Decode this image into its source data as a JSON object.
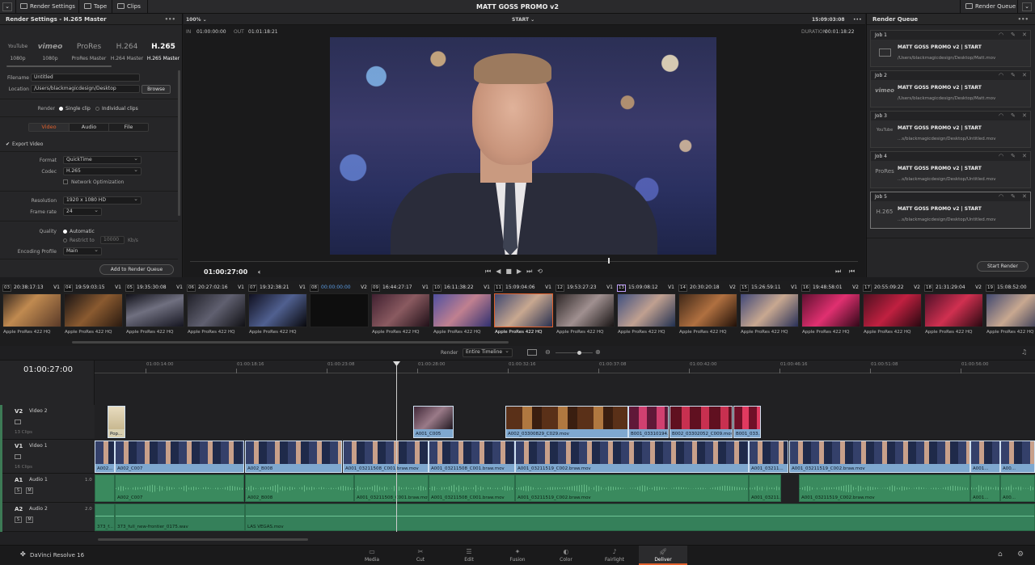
{
  "topbar": {
    "render_settings": "Render Settings",
    "tape": "Tape",
    "clips": "Clips",
    "project_title": "MATT GOSS PROMO v2",
    "render_queue": "Render Queue"
  },
  "render_settings": {
    "header": "Render Settings - H.265 Master",
    "presets": [
      {
        "name": "YouTube",
        "sub": "1080p"
      },
      {
        "name": "vimeo",
        "sub": "1080p"
      },
      {
        "name": "ProRes",
        "sub": "ProRes Master"
      },
      {
        "name": "H.264",
        "sub": "H.264 Master"
      },
      {
        "name": "H.265",
        "sub": "H.265 Master"
      }
    ],
    "filename_label": "Filename",
    "filename_value": "Untitled",
    "location_label": "Location",
    "location_value": "/Users/blackmagicdesign/Desktop",
    "browse": "Browse",
    "render_label": "Render",
    "single_clip": "Single clip",
    "individual_clips": "Individual clips",
    "tabs": [
      "Video",
      "Audio",
      "File"
    ],
    "export_video": "Export Video",
    "format_label": "Format",
    "format_value": "QuickTime",
    "codec_label": "Codec",
    "codec_value": "H.265",
    "network_opt": "Network Optimization",
    "resolution_label": "Resolution",
    "resolution_value": "1920 x 1080 HD",
    "framerate_label": "Frame rate",
    "framerate_value": "24",
    "quality_label": "Quality",
    "automatic": "Automatic",
    "restrict_to": "Restrict to",
    "restrict_value": "10000",
    "restrict_unit": "Kb/s",
    "encoding_label": "Encoding Profile",
    "encoding_value": "Main",
    "add_to_queue": "Add to Render Queue"
  },
  "viewer": {
    "zoom": "100%",
    "marker": "START",
    "timecode": "15:09:03:08",
    "in_label": "IN",
    "in_value": "01:00:00:00",
    "out_label": "OUT",
    "out_value": "01:01:18:21",
    "duration_label": "DURATION",
    "duration_value": "00:01:18:22",
    "current_time": "01:00:27:00"
  },
  "render_queue": {
    "header": "Render Queue",
    "start_render": "Start Render",
    "jobs": [
      {
        "label": "Job 1",
        "logo": "",
        "title": "MATT GOSS PROMO v2 | START",
        "path": "/Users/blackmagicdesign/Desktop/Matt.mov"
      },
      {
        "label": "Job 2",
        "logo": "vimeo",
        "title": "MATT GOSS PROMO v2 | START",
        "path": "/Users/blackmagicdesign/Desktop/Matt.mov"
      },
      {
        "label": "Job 3",
        "logo": "YouTube",
        "title": "MATT GOSS PROMO v2 | START",
        "path": "...s/blackmagicdesign/Desktop/Untitled.mov"
      },
      {
        "label": "Job 4",
        "logo": "ProRes",
        "title": "MATT GOSS PROMO v2 | START",
        "path": "...s/blackmagicdesign/Desktop/Untitled.mov"
      },
      {
        "label": "Job 5",
        "logo": "H.265",
        "title": "MATT GOSS PROMO v2 | START",
        "path": "...s/blackmagicdesign/Desktop/Untitled.mov"
      }
    ]
  },
  "clips": [
    {
      "num": "03",
      "tc": "20:38:17:13",
      "track": "V1",
      "codec": "Apple ProRes 422 HQ"
    },
    {
      "num": "04",
      "tc": "19:59:03:15",
      "track": "V1",
      "codec": "Apple ProRes 422 HQ"
    },
    {
      "num": "05",
      "tc": "19:35:30:08",
      "track": "V1",
      "codec": "Apple ProRes 422 HQ"
    },
    {
      "num": "06",
      "tc": "20:27:02:16",
      "track": "V1",
      "codec": "Apple ProRes 422 HQ"
    },
    {
      "num": "07",
      "tc": "19:32:38:21",
      "track": "V1",
      "codec": "Apple ProRes 422 HQ"
    },
    {
      "num": "08",
      "tc": "00:00:00:00",
      "track": "V2",
      "codec": ""
    },
    {
      "num": "09",
      "tc": "16:44:27:17",
      "track": "V1",
      "codec": "Apple ProRes 422 HQ"
    },
    {
      "num": "10",
      "tc": "16:11:38:22",
      "track": "V1",
      "codec": "Apple ProRes 422 HQ"
    },
    {
      "num": "11",
      "tc": "15:09:04:06",
      "track": "V1",
      "codec": "Apple ProRes 422 HQ"
    },
    {
      "num": "12",
      "tc": "19:53:27:23",
      "track": "V1",
      "codec": "Apple ProRes 422 HQ"
    },
    {
      "num": "13",
      "tc": "15:09:08:12",
      "track": "V1",
      "codec": "Apple ProRes 422 HQ"
    },
    {
      "num": "14",
      "tc": "20:30:20:18",
      "track": "V2",
      "codec": "Apple ProRes 422 HQ"
    },
    {
      "num": "15",
      "tc": "15:26:59:11",
      "track": "V1",
      "codec": "Apple ProRes 422 HQ"
    },
    {
      "num": "16",
      "tc": "19:48:58:01",
      "track": "V2",
      "codec": "Apple ProRes 422 HQ"
    },
    {
      "num": "17",
      "tc": "20:55:09:22",
      "track": "V2",
      "codec": "Apple ProRes 422 HQ"
    },
    {
      "num": "18",
      "tc": "21:31:29:04",
      "track": "V2",
      "codec": "Apple ProRes 422 HQ"
    },
    {
      "num": "19",
      "tc": "15:08:52:00",
      "track": "",
      "codec": "Apple ProRes 422 HQ"
    }
  ],
  "timeline": {
    "render_label": "Render",
    "render_value": "Entire Timeline",
    "timecode": "01:00:27:00",
    "ruler": [
      "01:00:14:00",
      "01:00:18:16",
      "01:00:23:08",
      "01:00:28:00",
      "01:00:32:16",
      "01:00:37:08",
      "01:00:42:00",
      "01:00:46:16",
      "01:00:51:08",
      "01:00:56:00"
    ],
    "tracks": {
      "v2": {
        "tag": "V2",
        "name": "Video 2",
        "count": "13 Clips"
      },
      "v1": {
        "tag": "V1",
        "name": "Video 1",
        "count": "16 Clips"
      },
      "a1": {
        "tag": "A1",
        "name": "Audio 1",
        "level": "1.0"
      },
      "a2": {
        "tag": "A2",
        "name": "Audio 2",
        "level": "2.0"
      }
    },
    "v2_clips": [
      "Pop...",
      "A001_C005",
      "A002_03300829_C029.mov",
      "B001_03310194...",
      "B002_03302052_C009.mov",
      "B001_033..."
    ],
    "v1_clips": [
      "A002...",
      "A002_C007",
      "A002_B008",
      "A001_03211508_C001.braw.mov",
      "A001_03211508_C001.braw.mov",
      "A001_03211519_C002.braw.mov",
      "A001_03211...",
      "A001_03211519_C002.braw.mov",
      "A001...",
      "A00..."
    ],
    "a1_clips": [
      "A002_C007",
      "A002_B008",
      "A001_03211508_C001.braw.mov",
      "A001_03211508_C001.braw.mov",
      "A001_03211519_C002.braw.mov",
      "A001_03211...",
      "A001_03211519_C002.braw.mov",
      "A001...",
      "A00..."
    ],
    "a2_clips": [
      "373_f...",
      "373_full_new-frontier_0175.wav",
      "LAS VEGAS.mov"
    ]
  },
  "bottom": {
    "app_name": "DaVinci Resolve 16",
    "pages": [
      "Media",
      "Cut",
      "Edit",
      "Fusion",
      "Color",
      "Fairlight",
      "Deliver"
    ]
  }
}
